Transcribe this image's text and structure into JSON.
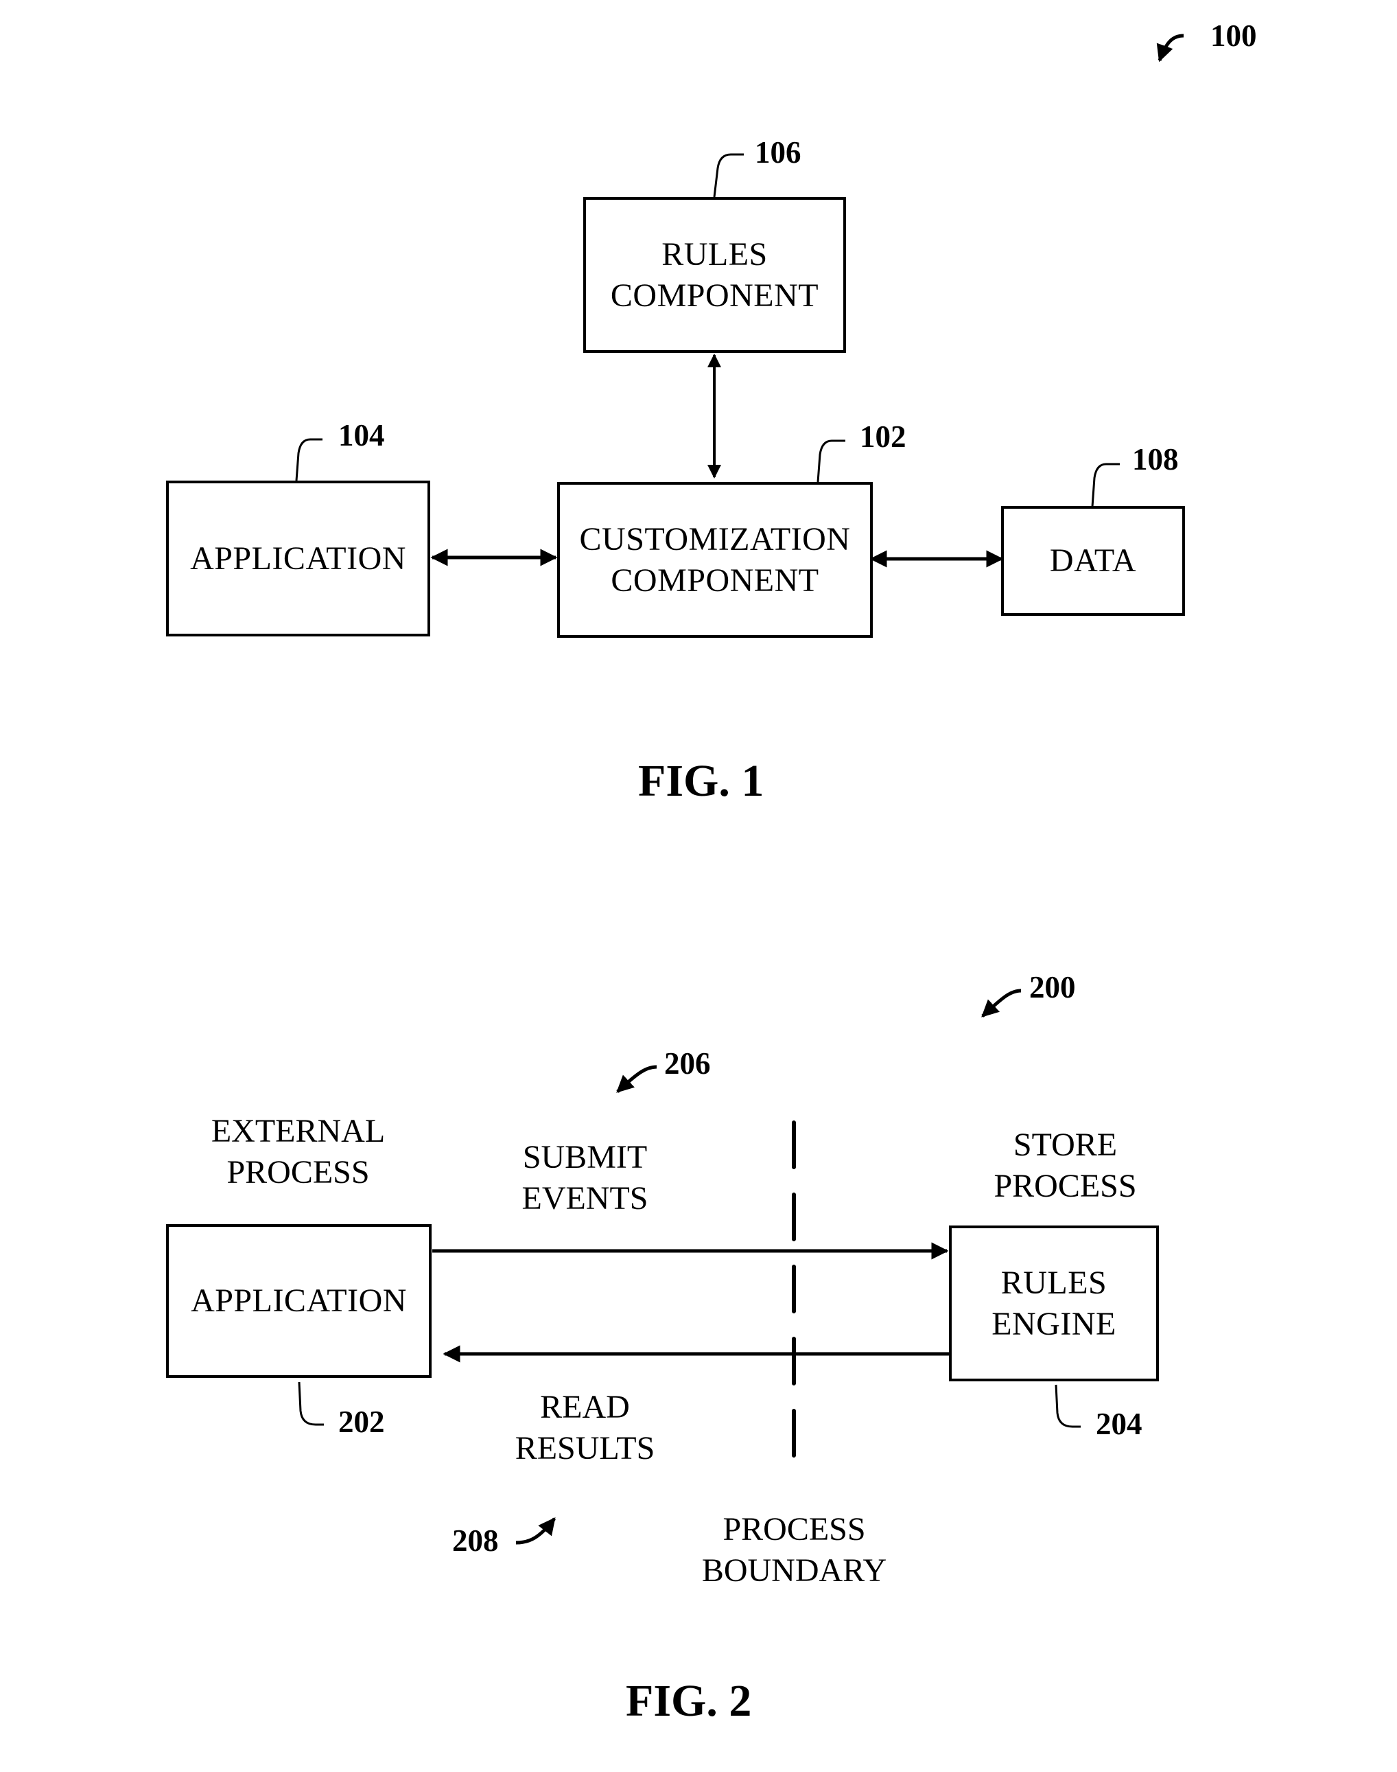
{
  "fig1": {
    "ref": "100",
    "caption": "FIG. 1",
    "rules_component": {
      "ref": "106",
      "line1": "RULES",
      "line2": "COMPONENT"
    },
    "application": {
      "ref": "104",
      "label": "APPLICATION"
    },
    "customization_component": {
      "ref": "102",
      "line1": "CUSTOMIZATION",
      "line2": "COMPONENT"
    },
    "data": {
      "ref": "108",
      "label": "DATA"
    }
  },
  "fig2": {
    "ref": "200",
    "caption": "FIG. 2",
    "external_process": {
      "line1": "EXTERNAL",
      "line2": "PROCESS"
    },
    "store_process": {
      "line1": "STORE",
      "line2": "PROCESS"
    },
    "application": {
      "ref": "202",
      "label": "APPLICATION"
    },
    "rules_engine": {
      "ref": "204",
      "line1": "RULES",
      "line2": "ENGINE"
    },
    "submit_events": {
      "ref": "206",
      "line1": "SUBMIT",
      "line2": "EVENTS"
    },
    "read_results": {
      "ref": "208",
      "line1": "READ",
      "line2": "RESULTS"
    },
    "process_boundary": {
      "line1": "PROCESS",
      "line2": "BOUNDARY"
    }
  }
}
